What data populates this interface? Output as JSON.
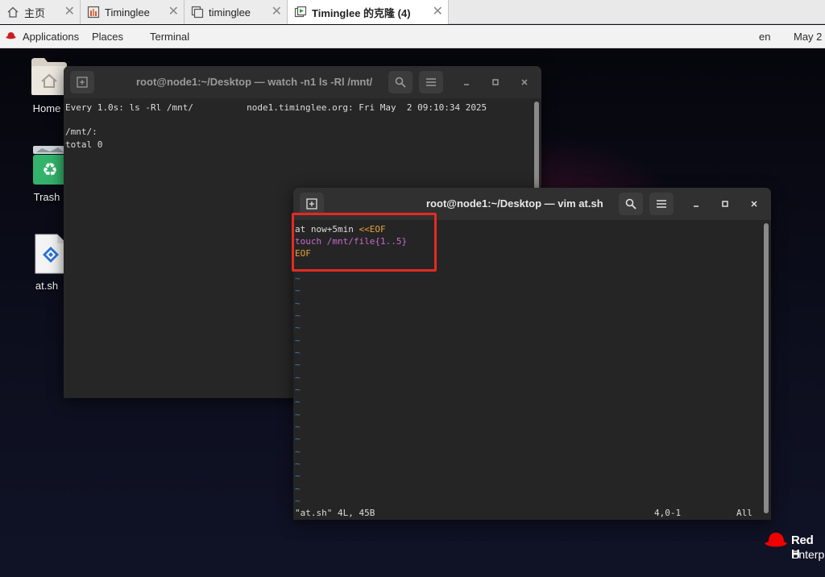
{
  "browser_tabs": [
    {
      "label": "主页",
      "icon": "home-icon",
      "active": false
    },
    {
      "label": "Timinglee",
      "icon": "vm-icon",
      "active": false
    },
    {
      "label": "timinglee",
      "icon": "vm-copy-icon",
      "active": false
    },
    {
      "label": "Timinglee 的克隆 (4)",
      "icon": "vm-running-icon",
      "active": true
    }
  ],
  "tab_close_glyph": "✕",
  "topbar": {
    "applications": "Applications",
    "places": "Places",
    "terminal": "Terminal",
    "lang": "en",
    "clock": "May 2"
  },
  "desktop_icons": [
    {
      "label": "Home",
      "icon": "folder-home-icon"
    },
    {
      "label": "Trash",
      "icon": "trash-icon"
    },
    {
      "label": "at.sh",
      "icon": "script-file-icon"
    }
  ],
  "watch_window": {
    "title": "root@node1:~/Desktop — watch -n1 ls -Rl /mnt/",
    "lines": [
      "Every 1.0s: ls -Rl /mnt/          node1.timinglee.org: Fri May  2 09:10:34 2025",
      "",
      "/mnt/:",
      "total 0"
    ]
  },
  "vim_window": {
    "title": "root@node1:~/Desktop — vim at.sh",
    "code": [
      {
        "text": "at now+5min ",
        "hl": "<<EOF"
      },
      {
        "text": "touch /mnt/file{1..5}"
      },
      {
        "text": "EOF"
      }
    ],
    "tilde": "~",
    "status_left": "\"at.sh\" 4L, 45B",
    "status_pos": "4,0-1",
    "status_right": "All"
  },
  "brand": {
    "line1": "Red H",
    "line2": "Enterp"
  },
  "colors": {
    "highlight_box": "#e32b22",
    "vim_tilde": "#3d7fbf",
    "vim_orange": "#e6a338",
    "vim_purple": "#c66bcb"
  }
}
